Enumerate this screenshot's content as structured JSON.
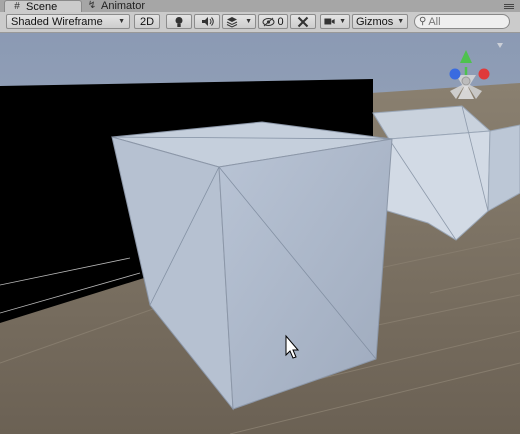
{
  "tabs": [
    {
      "label": "Scene",
      "icon": "hash-icon",
      "active": true
    },
    {
      "label": "Animator",
      "icon": "animator-icon",
      "active": false
    }
  ],
  "toolbar": {
    "draw_mode": "Shaded Wireframe",
    "mode_2d": "2D",
    "hidden_count": "0",
    "gizmos": "Gizmos",
    "search_placeholder": "All"
  },
  "colors": {
    "sky": "#8a9bb6",
    "ground": "#766b5e",
    "cube_front": "#aab6c9",
    "cube_top": "#c5cfdc",
    "cube_side": "#b8c3d2",
    "axis_y": "#4ec24e",
    "axis_x": "#e03a3a",
    "axis_z": "#3a6be0"
  },
  "icons": [
    "hash-icon",
    "animator-icon",
    "light-bulb-icon",
    "speaker-icon",
    "layers-icon",
    "eye-slash-icon",
    "tools-icon",
    "camera-icon",
    "search-icon",
    "menu-icon",
    "mouse-cursor-icon"
  ]
}
